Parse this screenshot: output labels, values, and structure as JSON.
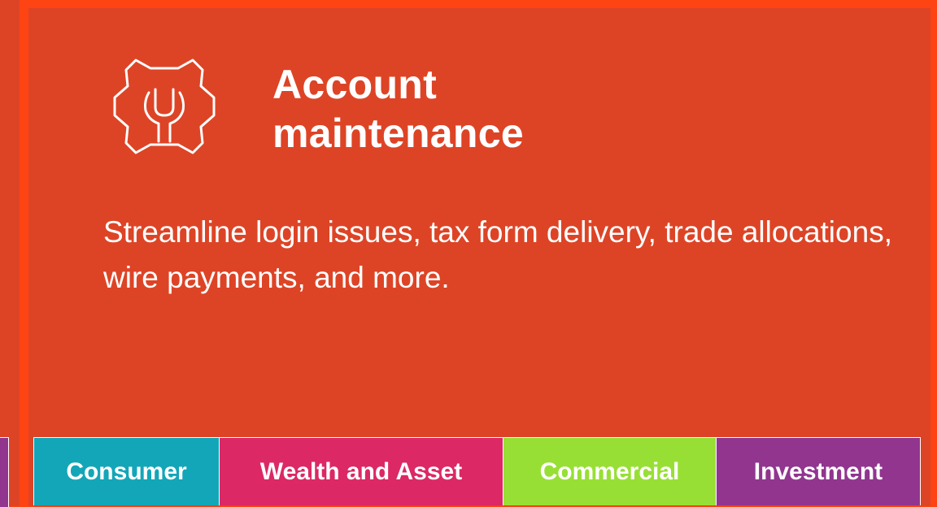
{
  "card": {
    "icon": "gear-wrench-icon",
    "title_line1": "Account",
    "title_line2": "maintenance",
    "description": "Streamline login issues, tax form delivery, trade allocations, wire payments, and more."
  },
  "tags": [
    {
      "label": "Consumer",
      "color": "#13A6B8"
    },
    {
      "label": "Wealth and Asset",
      "color": "#DC2864"
    },
    {
      "label": "Commercial",
      "color": "#98DF35"
    },
    {
      "label": "Investment",
      "color": "#91358F"
    }
  ],
  "colors": {
    "background": "#FF4414",
    "card": "#DD4426",
    "text": "#FFFFFF"
  }
}
